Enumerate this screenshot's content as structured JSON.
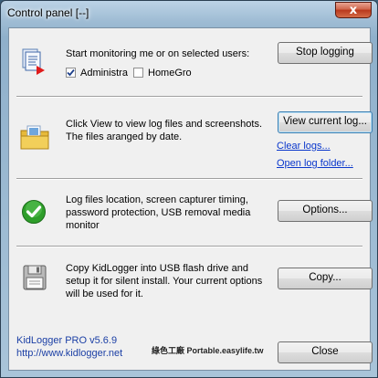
{
  "window": {
    "title": "Control panel",
    "title_suffix": "[--]",
    "close_glyph": "x"
  },
  "monitor": {
    "icon": "document-stack-icon",
    "text": "Start monitoring me or on selected users:",
    "button": "Stop logging",
    "users": [
      {
        "label": "Administra",
        "checked": true
      },
      {
        "label": "HomeGrou",
        "checked": false
      }
    ]
  },
  "logs": {
    "icon": "folder-icon",
    "text_line1": "Click View to view log files and screenshots.",
    "text_line2": "The files aranged by date.",
    "button": "View current log...",
    "clear_link": "Clear logs...",
    "open_link": "Open log folder..."
  },
  "options": {
    "icon": "green-check-icon",
    "text_line1": "Log files location, screen capturer timing,",
    "text_line2": "password protection, USB removal media",
    "text_line3": "monitor",
    "button": "Options..."
  },
  "copy": {
    "icon": "floppy-disk-icon",
    "text_line1": "Copy KidLogger into USB flash drive and",
    "text_line2": "setup it for silent install. Your current options",
    "text_line3": "will be used for it.",
    "button": "Copy..."
  },
  "footer": {
    "product": "KidLogger PRO  v5.6.9",
    "url": "http://www.kidlogger.net",
    "watermark": "綠色工廠 Portable.easylife.tw",
    "close_button": "Close"
  },
  "colors": {
    "link": "#0a37cc",
    "product_text": "#1b3fa5",
    "check_green": "#2e9e2a"
  }
}
